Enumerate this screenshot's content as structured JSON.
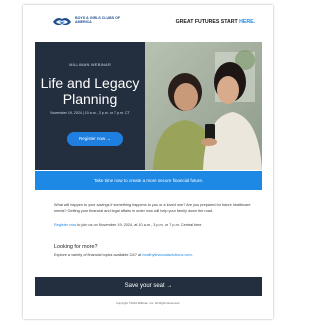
{
  "header": {
    "logo_text": "BOYS & GIRLS CLUBS OF AMERICA",
    "tagline_main": "GREAT FUTURES START ",
    "tagline_accent": "HERE."
  },
  "hero": {
    "label": "MILLIMAN WEBINAR",
    "title": "Life and Legacy Planning",
    "date": "November 19, 2024 | 10 a.m., 3 p.m. or 7 p.m. CT",
    "register_button": "Register now →"
  },
  "banner": {
    "text": "Take time now to create a more secure financial future."
  },
  "body": {
    "para1": "What will happen to your savings if something happens to you or a loved one? Are you prepared for future healthcare needs? Getting your financial and legal affairs in order now will help your family down the road.",
    "para2_link": "Register now",
    "para2_rest": " to join us on November 19, 2024, at 10 a.m., 3 p.m. or 7 p.m. Central time.",
    "more_heading": "Looking for more?",
    "more_text": "Explore a variety of financial topics available 24/7 at ",
    "more_link": "healthyfinancialsolutions.com",
    "more_end": "."
  },
  "save_button": "Save your seat →",
  "footer": "Copyright ©2024 Milliman, Inc. All Rights Reserved.",
  "colors": {
    "accent": "#1e88e5",
    "dark": "#232f3e"
  }
}
